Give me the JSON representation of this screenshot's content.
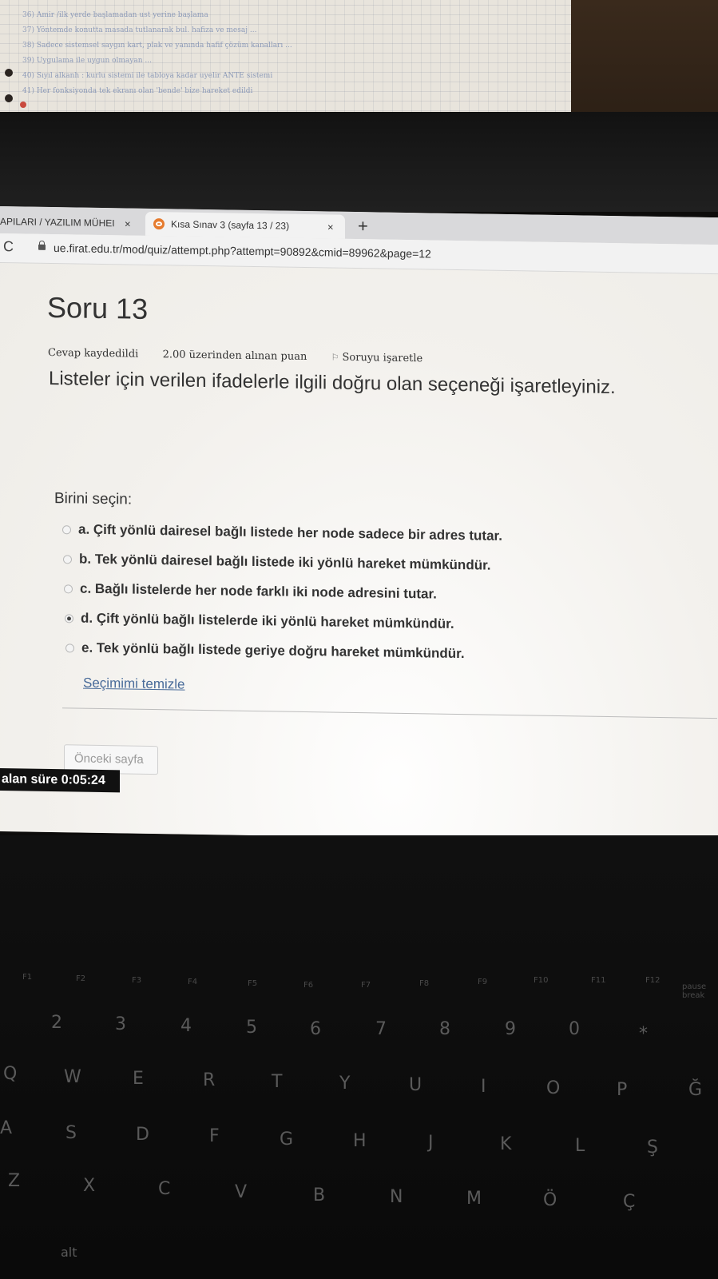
{
  "browser": {
    "tabs": [
      {
        "label": "APILARI / YAZILIM MÜHEI",
        "active": false
      },
      {
        "label": "Kısa Sınav 3 (sayfa 13 / 23)",
        "active": true
      }
    ],
    "tab_close_glyph": "×",
    "new_tab_glyph": "+",
    "reload_glyph": "C",
    "url": "ue.firat.edu.tr/mod/quiz/attempt.php?attempt=90892&cmid=89962&page=12"
  },
  "question": {
    "title": "Soru 13",
    "status": "Cevap kaydedildi",
    "points": "2.00 üzerinden alınan puan",
    "flag_label": "Soruyu işaretle",
    "text": "Listeler için verilen ifadelerle ilgili doğru olan seçeneği işaretleyiniz.",
    "choose_label": "Birini seçin:",
    "options": [
      {
        "label": "a. Çift yönlü dairesel bağlı listede her node sadece bir adres tutar.",
        "checked": false
      },
      {
        "label": "b. Tek yönlü dairesel bağlı listede iki yönlü hareket mümkündür.",
        "checked": false
      },
      {
        "label": "c. Bağlı listelerde her node farklı iki node adresini tutar.",
        "checked": false
      },
      {
        "label": "d. Çift yönlü bağlı listelerde iki yönlü hareket mümkündür.",
        "checked": true
      },
      {
        "label": "e. Tek yönlü bağlı listede geriye doğru hareket mümkündür.",
        "checked": false
      }
    ],
    "clear_label": "Seçimimi temizle"
  },
  "navigation": {
    "prev_label": "Önceki sayfa"
  },
  "timer": {
    "label": "alan süre ",
    "value": "0:05:24"
  },
  "notes": {
    "lines": [
      "36) Amir /ilk yerde başlamadan ust yerine başlama",
      "37) Yöntemde konutta masada tutlanarak bul. hafiza ve mesaj ...",
      "38) Sadece sistemsel saygın kart, plak ve yanında hafif çözüm kanalları ...",
      "39) Uygulama ile uygun olmayan ...",
      "40) Sıyıl alkanh : kurlu sistemi ile tabloya kadar uyelir ANTE sistemi",
      "41) Her fonksiyonda tek ekranı olan 'bende' bize hareket edildi"
    ]
  },
  "keyboard": {
    "fn_row": [
      "F1",
      "F2",
      "F3",
      "F4",
      "F5",
      "F6",
      "F7",
      "F8",
      "F9",
      "F10",
      "F11",
      "F12",
      "pause break"
    ],
    "number_row": [
      "2",
      "3",
      "4",
      "5",
      "6",
      "7",
      "8",
      "9",
      "0",
      "*"
    ],
    "top_row": [
      "Q",
      "W",
      "E",
      "R",
      "T",
      "Y",
      "U",
      "I",
      "O",
      "P",
      "Ğ"
    ],
    "home_row": [
      "A",
      "S",
      "D",
      "F",
      "G",
      "H",
      "J",
      "K",
      "L",
      "Ş"
    ],
    "bottom_row": [
      "Z",
      "X",
      "C",
      "V",
      "B",
      "N",
      "M",
      "Ö",
      "Ç"
    ],
    "alt_label": "alt"
  }
}
